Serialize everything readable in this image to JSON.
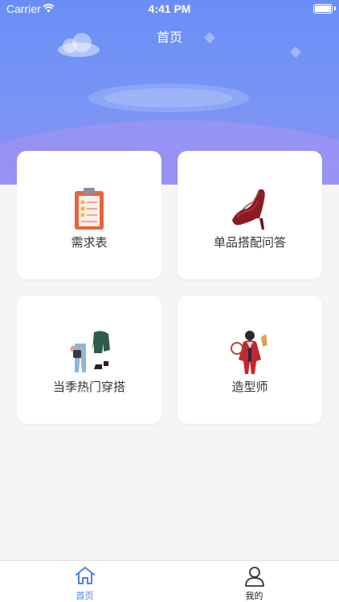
{
  "status_bar": {
    "carrier": "Carrier",
    "time": "4:41 PM"
  },
  "header": {
    "title": "首页"
  },
  "cards": [
    {
      "label": "需求表",
      "icon": "clipboard-icon"
    },
    {
      "label": "单品搭配问答",
      "icon": "high-heel-icon"
    },
    {
      "label": "当季热门穿搭",
      "icon": "outfit-icon"
    },
    {
      "label": "造型师",
      "icon": "stylist-icon"
    }
  ],
  "tabbar": {
    "items": [
      {
        "label": "首页",
        "icon": "home-icon",
        "active": true
      },
      {
        "label": "我的",
        "icon": "profile-icon",
        "active": false
      }
    ]
  },
  "colors": {
    "accent": "#4a7df0",
    "hero_top": "#6a8ef6",
    "hero_bottom": "#8e8ff2"
  }
}
